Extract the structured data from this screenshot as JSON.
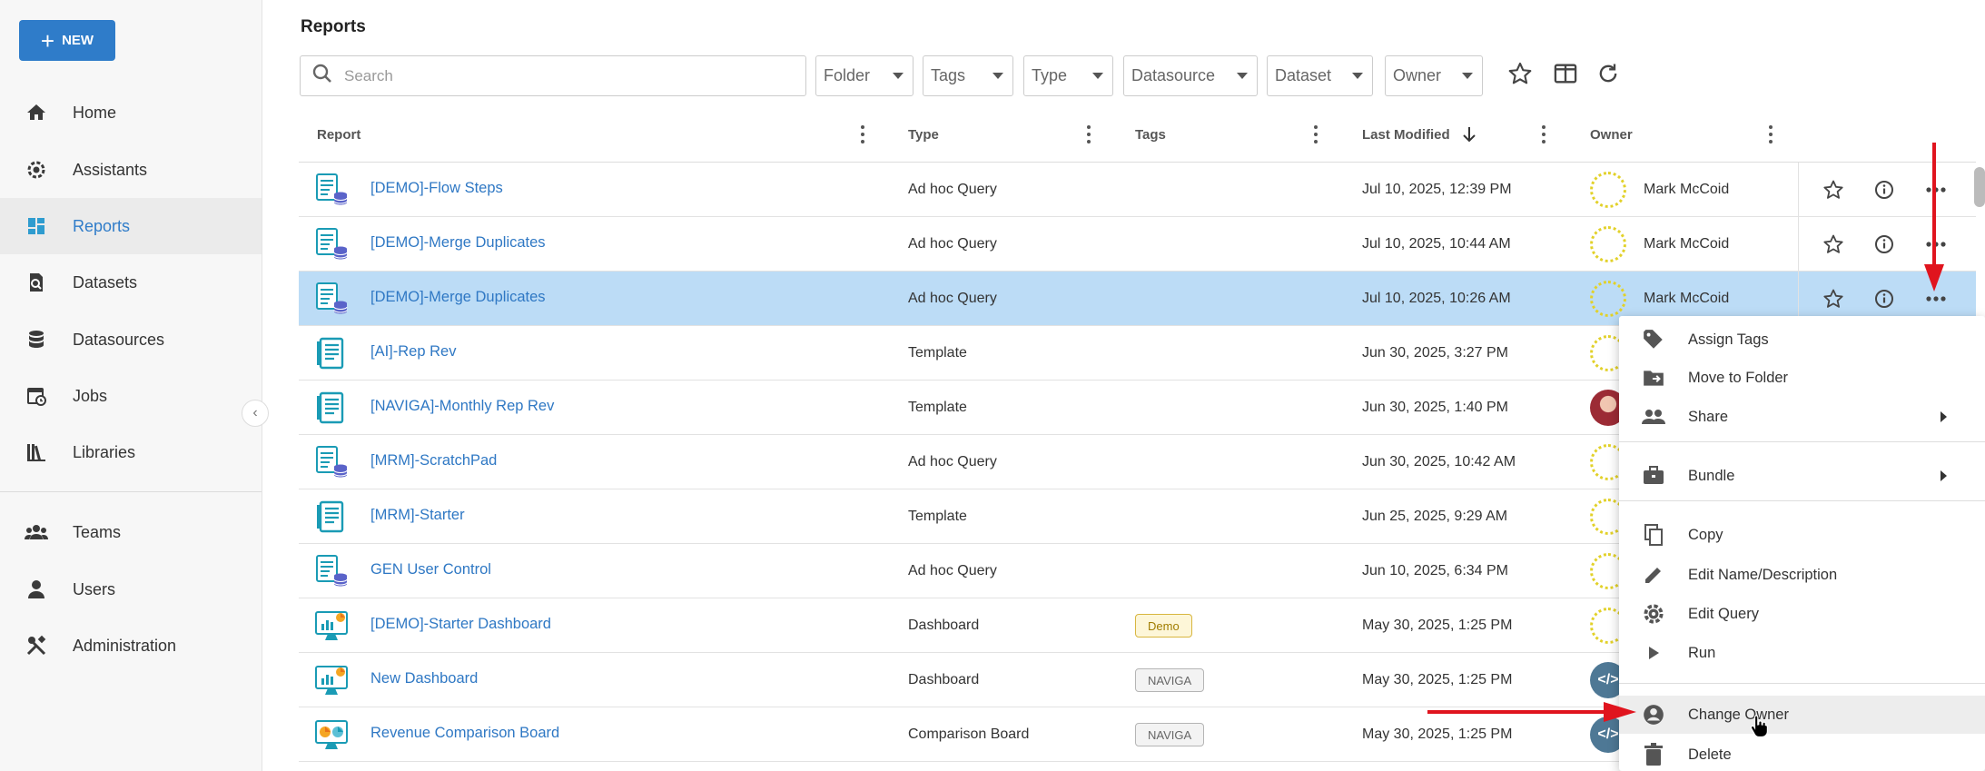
{
  "sidebar": {
    "new_label": "NEW",
    "items": [
      {
        "label": "Home",
        "icon": "home-icon"
      },
      {
        "label": "Assistants",
        "icon": "gear-icon"
      },
      {
        "label": "Reports",
        "icon": "dashboard-icon",
        "active": true
      },
      {
        "label": "Datasets",
        "icon": "dataset-icon"
      },
      {
        "label": "Datasources",
        "icon": "database-icon"
      },
      {
        "label": "Jobs",
        "icon": "calendar-icon"
      },
      {
        "label": "Libraries",
        "icon": "library-icon"
      },
      {
        "label": "Teams",
        "icon": "group-icon"
      },
      {
        "label": "Users",
        "icon": "user-icon"
      },
      {
        "label": "Administration",
        "icon": "tools-icon"
      }
    ]
  },
  "header": {
    "title": "Reports",
    "search_placeholder": "Search",
    "filters": [
      "Folder",
      "Tags",
      "Type",
      "Datasource",
      "Dataset",
      "Owner"
    ]
  },
  "table": {
    "columns": [
      "Report",
      "Type",
      "Tags",
      "Last Modified",
      "Owner"
    ],
    "sort_column": "Last Modified",
    "sort_direction": "descending",
    "rows": [
      {
        "name": "[DEMO]-Flow Steps",
        "type": "Ad hoc Query",
        "tag": "",
        "modified": "Jul 10, 2025, 12:39 PM",
        "owner": "Mark McCoid",
        "icon": "adhoc",
        "avatar": "dotted"
      },
      {
        "name": "[DEMO]-Merge Duplicates",
        "type": "Ad hoc Query",
        "tag": "",
        "modified": "Jul 10, 2025, 10:44 AM",
        "owner": "Mark McCoid",
        "icon": "adhoc",
        "avatar": "dotted"
      },
      {
        "name": "[DEMO]-Merge Duplicates",
        "type": "Ad hoc Query",
        "tag": "",
        "modified": "Jul 10, 2025, 10:26 AM",
        "owner": "Mark McCoid",
        "icon": "adhoc",
        "avatar": "dotted",
        "selected": true
      },
      {
        "name": "[AI]-Rep Rev",
        "type": "Template",
        "tag": "",
        "modified": "Jun 30, 2025, 3:27 PM",
        "owner": "",
        "icon": "template",
        "avatar": "dotted"
      },
      {
        "name": "[NAVIGA]-Monthly Rep Rev",
        "type": "Template",
        "tag": "",
        "modified": "Jun 30, 2025, 1:40 PM",
        "owner": "",
        "icon": "template",
        "avatar": "photo"
      },
      {
        "name": "[MRM]-ScratchPad",
        "type": "Ad hoc Query",
        "tag": "",
        "modified": "Jun 30, 2025, 10:42 AM",
        "owner": "",
        "icon": "adhoc",
        "avatar": "dotted"
      },
      {
        "name": "[MRM]-Starter",
        "type": "Template",
        "tag": "",
        "modified": "Jun 25, 2025, 9:29 AM",
        "owner": "",
        "icon": "template",
        "avatar": "dotted"
      },
      {
        "name": "GEN User Control",
        "type": "Ad hoc Query",
        "tag": "",
        "modified": "Jun 10, 2025, 6:34 PM",
        "owner": "",
        "icon": "adhoc",
        "avatar": "dotted"
      },
      {
        "name": "[DEMO]-Starter Dashboard",
        "type": "Dashboard",
        "tag": "Demo",
        "modified": "May 30, 2025, 1:25 PM",
        "owner": "",
        "icon": "dashboard",
        "avatar": "dotted"
      },
      {
        "name": "New Dashboard",
        "type": "Dashboard",
        "tag": "NAVIGA",
        "modified": "May 30, 2025, 1:25 PM",
        "owner": "",
        "icon": "dashboard",
        "avatar": "code"
      },
      {
        "name": "Revenue Comparison Board",
        "type": "Comparison Board",
        "tag": "NAVIGA",
        "modified": "May 30, 2025, 1:25 PM",
        "owner": "",
        "icon": "comparison",
        "avatar": "code"
      }
    ]
  },
  "context_menu": {
    "items": [
      {
        "label": "Assign Tags",
        "icon": "tag-icon"
      },
      {
        "label": "Move to Folder",
        "icon": "folder-move-icon"
      },
      {
        "label": "Share",
        "icon": "people-icon",
        "submenu": true
      },
      {
        "label": "Bundle",
        "icon": "briefcase-icon",
        "submenu": true
      },
      {
        "label": "Copy",
        "icon": "copy-icon"
      },
      {
        "label": "Edit Name/Description",
        "icon": "pencil-icon"
      },
      {
        "label": "Edit Query",
        "icon": "gear-icon"
      },
      {
        "label": "Run",
        "icon": "play-icon"
      },
      {
        "label": "Change Owner",
        "icon": "account-circle-icon",
        "hovered": true
      },
      {
        "label": "Delete",
        "icon": "trash-icon"
      }
    ]
  },
  "colors": {
    "accent": "#2f7cc9",
    "link": "#2f78c4",
    "selected_row": "#bcdcf6",
    "annotation_arrow": "#e0141e"
  }
}
